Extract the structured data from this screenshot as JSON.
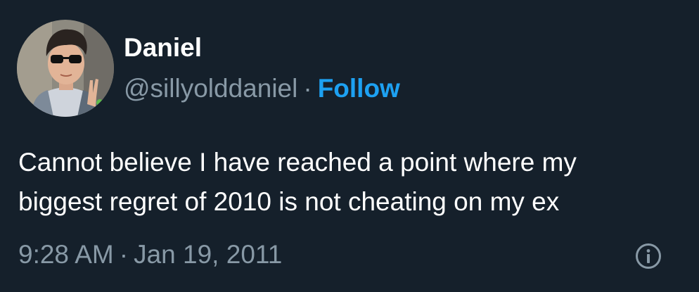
{
  "user": {
    "display_name": "Daniel",
    "handle": "@sillyolddaniel",
    "separator": "·",
    "follow_label": "Follow"
  },
  "tweet": {
    "text_lines": [
      "Cannot believe I have reached a point where my",
      "biggest regret of 2010 is not cheating on my ex"
    ],
    "time": "9:28 AM",
    "separator": "·",
    "date": "Jan 19, 2011"
  },
  "icons": {
    "info": "info-icon",
    "avatar": "avatar-photo"
  },
  "colors": {
    "background": "#15202b",
    "primary_text": "#ffffff",
    "secondary_text": "#8899a6",
    "accent": "#1da1f2"
  }
}
